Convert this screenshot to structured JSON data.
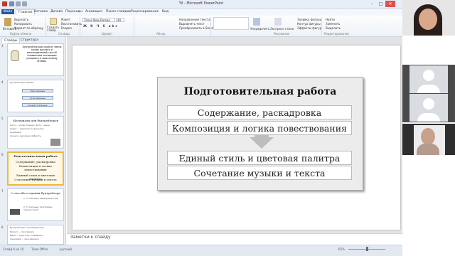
{
  "window": {
    "title": "Ýž - Microsoft PowerPoint"
  },
  "ribbon": {
    "tabs": [
      "Файл",
      "Главная",
      "Вставка",
      "Дизайн",
      "Переходы",
      "Анимация",
      "Показ слайдов",
      "Рецензирование",
      "Вид"
    ],
    "clipboard": {
      "paste": "Вставить",
      "cut": "Вырезать",
      "copy": "Копировать",
      "format": "Формат по образцу",
      "group": "Буфер обмена"
    },
    "slides": {
      "create": "Создать слайд",
      "layout": "Макет",
      "reset": "Восстановить",
      "section": "Раздел",
      "group": "Слайды"
    },
    "font": {
      "name": "Times New Roman",
      "size": "40",
      "group": "Шрифт"
    },
    "paragraph": {
      "group": "Абзац",
      "direction": "Направление текста",
      "align": "Выровнять текст",
      "smartart": "Преобразовать в SmartArt"
    },
    "drawing": {
      "arrange": "Упорядочить",
      "styles": "Экспресс-стили",
      "fill": "Заливка фигуры",
      "outline": "Контур фигуры",
      "effects": "Эффекты фигур",
      "group": "Рисование"
    },
    "editing": {
      "find": "Найти",
      "replace": "Заменить",
      "select": "Выделить",
      "group": "Редактирование"
    }
  },
  "left_panel": {
    "tabs": [
      "Слайды",
      "Структура"
    ],
    "thumbs": [
      {
        "num": "3",
        "title": "Буктрейлер как один из типов медиа проекта и инновационный способ повышения мотивации учащихся к смысловому чтению."
      },
      {
        "num": "4",
        "title": "Буктрейлеры бывают",
        "boxes": [
          "Рассказовые",
          "Атмосферные",
          "Концептуальные"
        ]
      },
      {
        "num": "5",
        "title": "Материалы для буктрейлеров",
        "lines": [
          "фото — иллюстрации, фото, сканы",
          "видео — фрагменты фильмов",
          "анимация",
          "музыка, звуковые эффекты"
        ]
      },
      {
        "num": "6",
        "title": "Подготовительная работа",
        "lines": [
          "Содержание, раскадровка",
          "Композиция и логика повествования",
          "Единый стиль и цветовая палитра",
          "Сочетание музыки и текста"
        ]
      },
      {
        "num": "7",
        "title": "2 способа создания буктрейлера",
        "lines": [
          "1. С помощью видеоредактора",
          "2. С помощью программы презентаций"
        ]
      },
      {
        "num": "8",
        "title": "Буктрейлеры, произведенные",
        "lines": [
          "Проект — программа",
          "Идея — короткое сообщение",
          "Сценарий — раскадровка"
        ]
      }
    ]
  },
  "slide": {
    "title": "Подготовительная работа",
    "items": [
      "Содержание, раскадровка",
      "Композиция и логика повествования",
      "Единый стиль и цветовая палитра",
      "Сочетание музыки и текста"
    ]
  },
  "notes": {
    "placeholder": "Заметки к слайду"
  },
  "status": {
    "slide": "Слайд 6 из 10",
    "theme": "Тема Office",
    "lang": "русский",
    "zoom": "65%"
  },
  "colors": {
    "file_tab": "#2b5797",
    "selected_thumb": "#f0b73c",
    "panel_bg": "#ececec"
  }
}
